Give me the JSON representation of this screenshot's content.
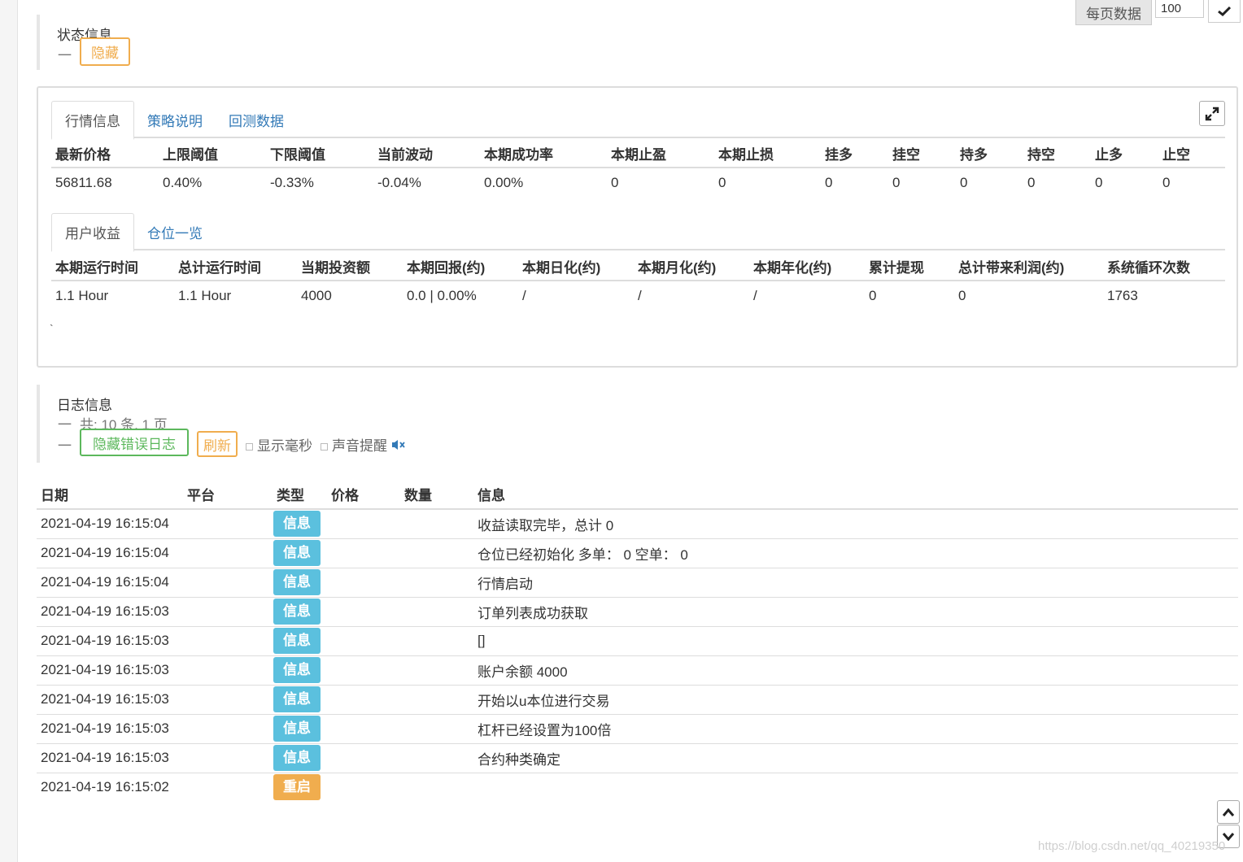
{
  "page_size": {
    "label": "每页数据",
    "value": "100"
  },
  "status": {
    "title": "状态信息",
    "dash": "一",
    "hide_label": "隐藏"
  },
  "market_tabs": [
    {
      "label": "行情信息",
      "active": true
    },
    {
      "label": "策略说明",
      "active": false
    },
    {
      "label": "回测数据",
      "active": false
    }
  ],
  "market_table": {
    "headers": [
      "最新价格",
      "上限阈值",
      "下限阈值",
      "当前波动",
      "本期成功率",
      "本期止盈",
      "本期止损",
      "挂多",
      "挂空",
      "持多",
      "持空",
      "止多",
      "止空"
    ],
    "row": [
      "56811.68",
      "0.40%",
      "-0.33%",
      "-0.04%",
      "0.00%",
      "0",
      "0",
      "0",
      "0",
      "0",
      "0",
      "0",
      "0"
    ]
  },
  "user_tabs": [
    {
      "label": "用户收益",
      "active": true
    },
    {
      "label": "仓位一览",
      "active": false
    }
  ],
  "user_table": {
    "headers": [
      "本期运行时间",
      "总计运行时间",
      "当期投资额",
      "本期回报(约)",
      "本期日化(约)",
      "本期月化(约)",
      "本期年化(约)",
      "累计提现",
      "总计带来利润(约)",
      "系统循环次数"
    ],
    "row": [
      "1.1 Hour",
      "1.1 Hour",
      "4000",
      "0.0 | 0.00%",
      "/",
      "/",
      "/",
      "0",
      "0",
      "1763"
    ]
  },
  "tick_mark": "`",
  "log": {
    "title": "日志信息",
    "dash": "一",
    "count_text": "共: 10 条, 1 页",
    "hide_errors_label": "隐藏错误日志",
    "refresh_label": "刷新",
    "show_ms_label": "显示毫秒",
    "sound_label": "声音提醒",
    "headers": [
      "日期",
      "平台",
      "类型",
      "价格",
      "数量",
      "信息"
    ],
    "rows": [
      {
        "date": "2021-04-19 16:15:04",
        "platform": "",
        "type": "信息",
        "price": "",
        "qty": "",
        "msg": "收益读取完毕，总计 0"
      },
      {
        "date": "2021-04-19 16:15:04",
        "platform": "",
        "type": "信息",
        "price": "",
        "qty": "",
        "msg": "仓位已经初始化 多单： 0 空单： 0"
      },
      {
        "date": "2021-04-19 16:15:04",
        "platform": "",
        "type": "信息",
        "price": "",
        "qty": "",
        "msg": "行情启动"
      },
      {
        "date": "2021-04-19 16:15:03",
        "platform": "",
        "type": "信息",
        "price": "",
        "qty": "",
        "msg": "订单列表成功获取"
      },
      {
        "date": "2021-04-19 16:15:03",
        "platform": "",
        "type": "信息",
        "price": "",
        "qty": "",
        "msg": "[]"
      },
      {
        "date": "2021-04-19 16:15:03",
        "platform": "",
        "type": "信息",
        "price": "",
        "qty": "",
        "msg": "账户余额 4000"
      },
      {
        "date": "2021-04-19 16:15:03",
        "platform": "",
        "type": "信息",
        "price": "",
        "qty": "",
        "msg": "开始以u本位进行交易"
      },
      {
        "date": "2021-04-19 16:15:03",
        "platform": "",
        "type": "信息",
        "price": "",
        "qty": "",
        "msg": "杠杆已经设置为100倍"
      },
      {
        "date": "2021-04-19 16:15:03",
        "platform": "",
        "type": "信息",
        "price": "",
        "qty": "",
        "msg": "合约种类确定"
      },
      {
        "date": "2021-04-19 16:15:02",
        "platform": "",
        "type": "重启",
        "price": "",
        "qty": "",
        "msg": ""
      }
    ]
  },
  "colors": {
    "info_badge": "#5bc0de",
    "restart_badge": "#f0ad4e",
    "link": "#337ab7",
    "orange": "#f0ad4e",
    "green": "#5cb85c"
  },
  "icons": {
    "expand": "expand-icon",
    "check": "check-icon",
    "mute": "speaker-mute-icon",
    "up": "chevron-up-icon",
    "down": "chevron-down-icon"
  },
  "watermark": "https://blog.csdn.net/qq_40219350"
}
